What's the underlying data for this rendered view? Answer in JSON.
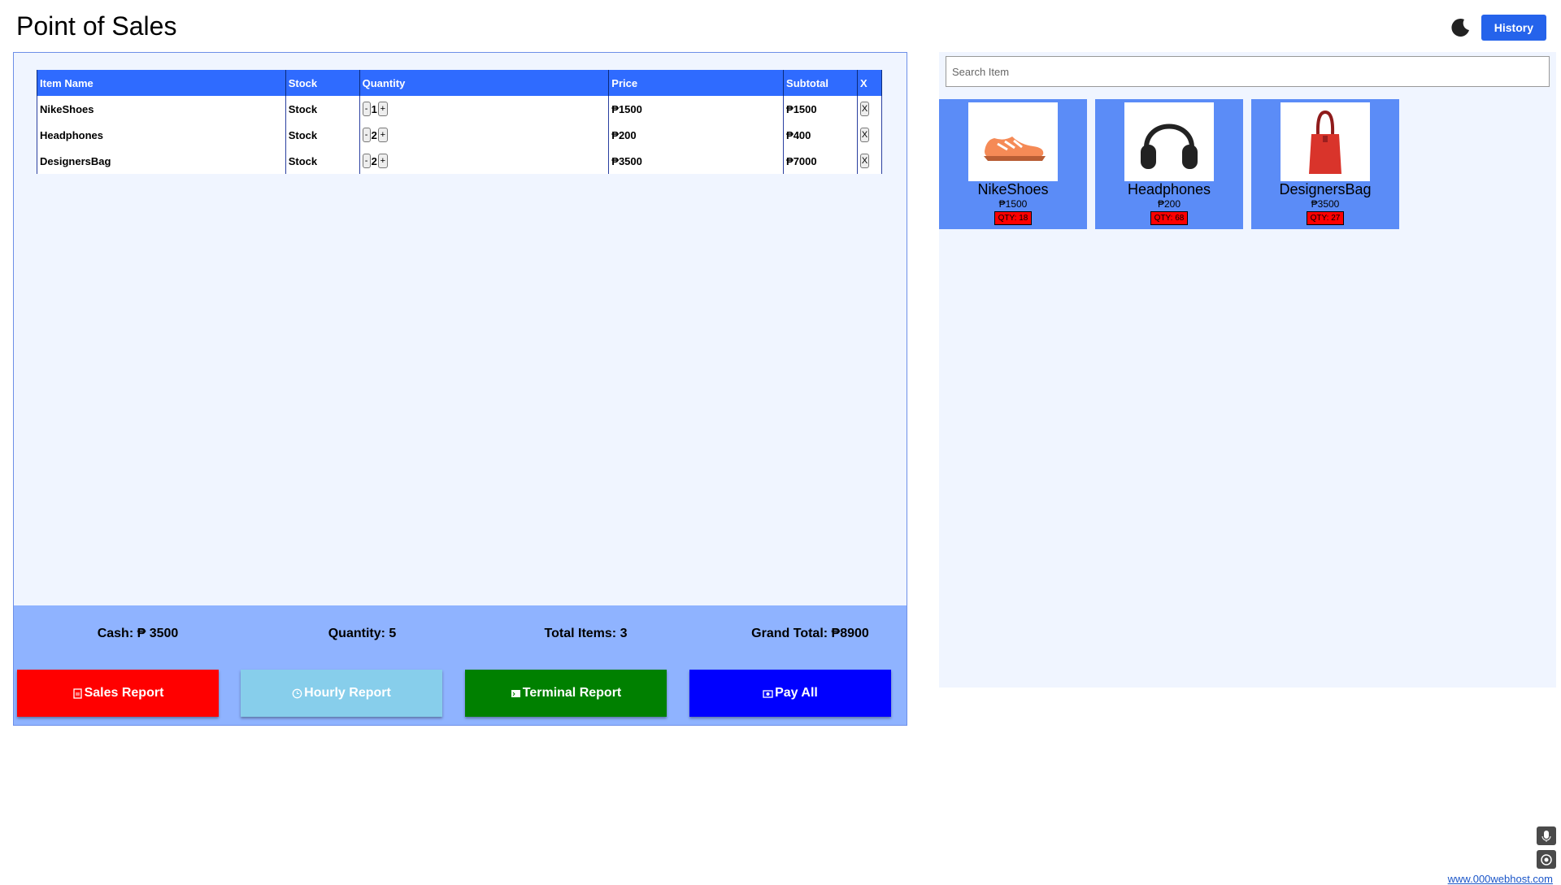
{
  "header": {
    "title": "Point of Sales",
    "history_label": "History",
    "theme_icon": "moon-icon"
  },
  "cart": {
    "columns": [
      "Item Name",
      "Stock",
      "Quantity",
      "Price",
      "Subtotal",
      "X"
    ],
    "rows": [
      {
        "name": "NikeShoes",
        "stock": "Stock",
        "minus": "-",
        "qty": "1",
        "plus": "+",
        "price": "₱1500",
        "subtotal": "₱1500",
        "remove": "X"
      },
      {
        "name": "Headphones",
        "stock": "Stock",
        "minus": "-",
        "qty": "2",
        "plus": "+",
        "price": "₱200",
        "subtotal": "₱400",
        "remove": "X"
      },
      {
        "name": "DesignersBag",
        "stock": "Stock",
        "minus": "-",
        "qty": "2",
        "plus": "+",
        "price": "₱3500",
        "subtotal": "₱7000",
        "remove": "X"
      }
    ]
  },
  "summary": {
    "cash": "Cash: ₱ 3500",
    "quantity": "Quantity: 5",
    "total_items": "Total Items: 3",
    "grand_total": "Grand Total: ₱8900"
  },
  "actions": {
    "sales_report": "Sales Report",
    "hourly_report": "Hourly Report",
    "terminal_report": "Terminal Report",
    "pay_all": "Pay All"
  },
  "catalog": {
    "search_placeholder": "Search Item",
    "products": [
      {
        "name": "NikeShoes",
        "price": "₱1500",
        "qty": "QTY: 18"
      },
      {
        "name": "Headphones",
        "price": "₱200",
        "qty": "QTY: 68"
      },
      {
        "name": "DesignersBag",
        "price": "₱3500",
        "qty": "QTY: 27"
      }
    ]
  },
  "footer": {
    "link": "www.000webhost.com"
  },
  "colors": {
    "primary": "#2f6bff",
    "panel": "#f0f5ff",
    "summary": "#8fb3ff",
    "sales": "#ff0000",
    "hourly": "#87ceeb",
    "terminal": "#008000",
    "pay": "#0000ff"
  }
}
